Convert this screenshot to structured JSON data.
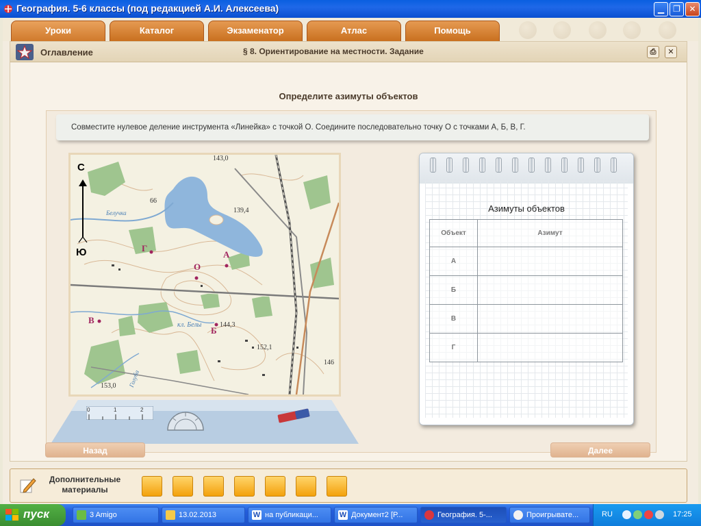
{
  "window": {
    "title": "География. 5-6 классы (под редакцией А.И. Алексеева)"
  },
  "nav": {
    "tabs": [
      {
        "label": "Уроки"
      },
      {
        "label": "Каталог"
      },
      {
        "label": "Экзаменатор"
      },
      {
        "label": "Атлас"
      },
      {
        "label": "Помощь"
      }
    ]
  },
  "header": {
    "toc_label": "Оглавление",
    "section_title": "§ 8. Ориентирование на местности. Задание"
  },
  "task": {
    "title": "Определите азимуты объектов",
    "instruction": "Совместите нулевое деление инструмента «Линейка» с точкой О. Соедините последовательно точку О с точками А, Б, В, Г."
  },
  "map": {
    "compass_north": "С",
    "compass_south": "Ю",
    "points": {
      "o": "О",
      "a": "А",
      "b": "Б",
      "v": "В",
      "g": "Г"
    },
    "labels": {
      "h143": "143,0",
      "h139": "139,4",
      "h66": "66",
      "beluchka": "Белучка",
      "kl_bely": "кл. Белы",
      "h144": "144,3",
      "h152": "152,1",
      "h146": "146",
      "h153": "153,0",
      "golubaya": "Голуба"
    }
  },
  "tools": {
    "ruler_ticks": [
      "0",
      "1",
      "2"
    ]
  },
  "notebook": {
    "title": "Азимуты объектов",
    "columns": [
      "Объект",
      "Азимут"
    ],
    "rows": [
      {
        "object": "А",
        "azimuth": ""
      },
      {
        "object": "Б",
        "azimuth": ""
      },
      {
        "object": "В",
        "azimuth": ""
      },
      {
        "object": "Г",
        "azimuth": ""
      }
    ]
  },
  "buttons": {
    "back": "Назад",
    "next": "Далее"
  },
  "footer": {
    "additional_materials": "Дополнительные материалы"
  },
  "taskbar": {
    "start": "пуск",
    "items": [
      {
        "label": "3 Amigo"
      },
      {
        "label": "13.02.2013"
      },
      {
        "label": "на публикаци..."
      },
      {
        "label": "Документ2 [Р..."
      },
      {
        "label": "География. 5-..."
      },
      {
        "label": "Проигрывате..."
      }
    ],
    "lang": "RU",
    "clock": "17:25"
  },
  "colors": {
    "title_bar": "#0a5fe0",
    "tab_orange": "#d07a2c",
    "point_marker": "#a0245e",
    "taskbar_blue": "#245edb",
    "start_green": "#3a8d30"
  }
}
